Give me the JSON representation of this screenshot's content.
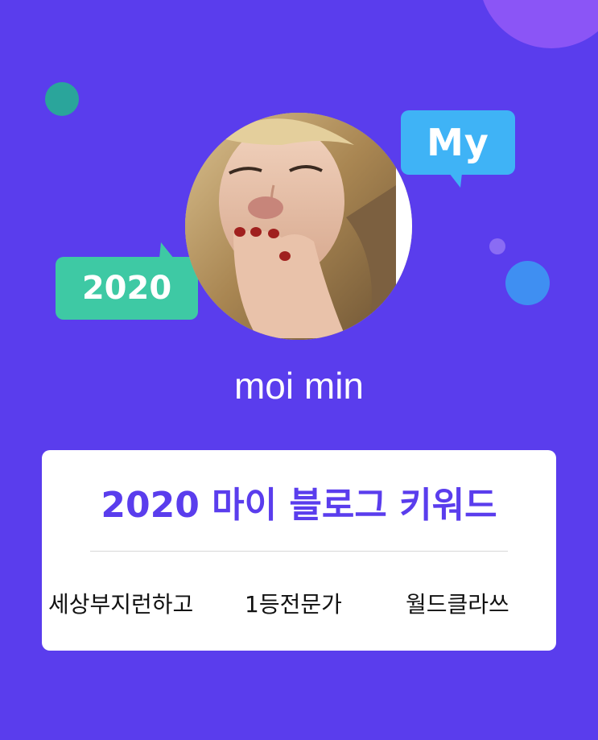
{
  "bubbles": {
    "my": "My",
    "year": "2020"
  },
  "profile": {
    "username": "moi min"
  },
  "card": {
    "title": "2020 마이 블로그 키워드",
    "keywords": [
      "세상부지런하고",
      "1등전문가",
      "월드클라쓰"
    ]
  },
  "colors": {
    "background": "#5a3ded",
    "accent": "#5a3ded",
    "bubble_my": "#3fb3f6",
    "bubble_year": "#3ec9a4"
  }
}
